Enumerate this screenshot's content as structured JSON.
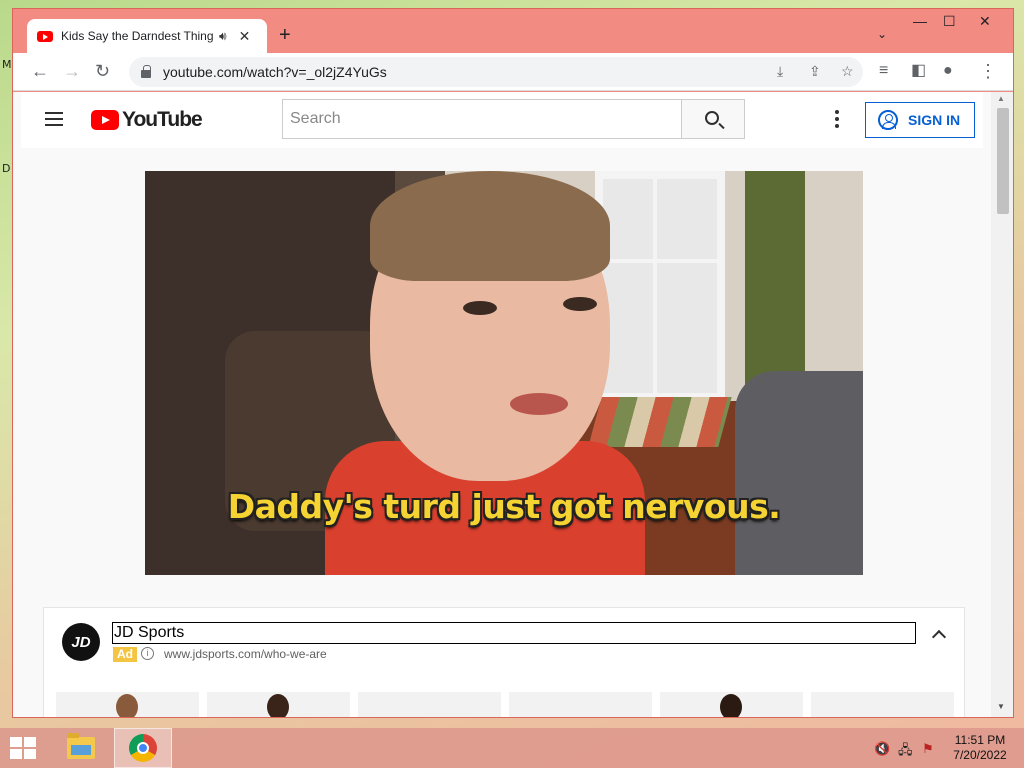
{
  "desktop": {
    "letters": [
      "M",
      "D"
    ]
  },
  "browser": {
    "tab": {
      "title": "Kids Say the Darndest Things",
      "audio_icon": "speaker-icon",
      "close_label": "✕"
    },
    "new_tab_label": "+",
    "tab_search_label": "⌄",
    "window_controls": {
      "minimize": "—",
      "maximize": "☐",
      "close": "✕"
    },
    "nav": {
      "back": "←",
      "forward": "→",
      "reload": "↻"
    },
    "url": "youtube.com/watch?v=_ol2jZ4YuGs",
    "omnibox_icons": {
      "install": "⤓",
      "share": "⇪",
      "bookmark": "☆"
    },
    "toolbar_icons": {
      "reading_list": "≡",
      "side_panel": "◧",
      "profile": "●",
      "menu": "⋮"
    }
  },
  "youtube": {
    "logo_text": "YouTube",
    "search_placeholder": "Search",
    "sign_in_label": "SIGN IN",
    "video": {
      "caption": "Daddy's turd just got nervous."
    },
    "ad": {
      "logo_text": "JD",
      "title": "JD Sports",
      "badge": "Ad",
      "info_label": "i",
      "url": "www.jdsports.com/who-we-are",
      "cards": [
        {
          "person_color": "#8a5a3c"
        },
        {
          "person_color": "#3a2318"
        },
        {
          "person_color": ""
        },
        {
          "person_color": ""
        },
        {
          "person_color": "#2a1a12"
        },
        {
          "person_color": ""
        }
      ]
    }
  },
  "scrollbar": {
    "up": "▲",
    "down": "▼",
    "thumb_position_fraction": 0.0
  },
  "taskbar": {
    "apps": [
      "file-explorer",
      "google-chrome"
    ],
    "tray": {
      "volume": "🔇",
      "network": "🖧",
      "flag": "⚑"
    },
    "time": "11:51 PM",
    "date": "7/20/2022"
  },
  "colors": {
    "browser_frame": "#f28b82",
    "youtube_red": "#ff0000",
    "sign_in_blue": "#065fd4",
    "caption_yellow": "#f5d332",
    "ad_badge_yellow": "#f4c542"
  }
}
